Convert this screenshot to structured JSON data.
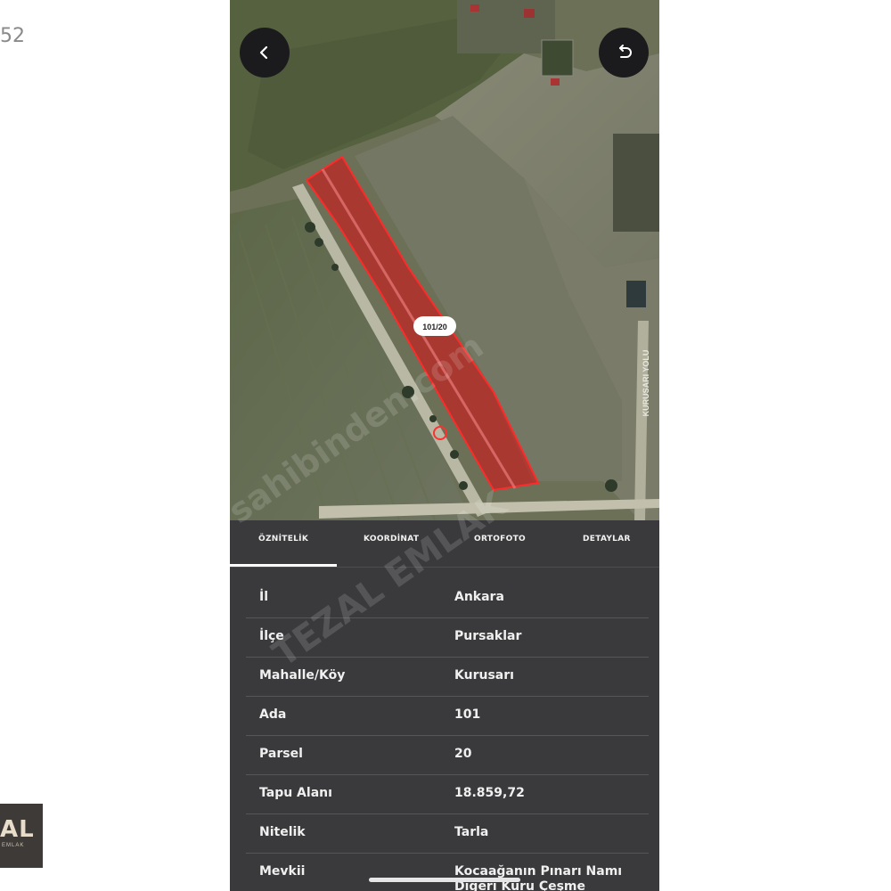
{
  "outer": {
    "time_fragment": "52",
    "logo_text": "AL",
    "logo_subtext": "EMLAK"
  },
  "map": {
    "parcel_label": "101/20",
    "road_label": "KURUSARI YOLU",
    "parcel_color": "#e02020"
  },
  "tabs": [
    {
      "label": "ÖZNİTELİK",
      "active": true
    },
    {
      "label": "KOORDİNAT",
      "active": false
    },
    {
      "label": "ORTOFOTO",
      "active": false
    },
    {
      "label": "DETAYLAR",
      "active": false
    }
  ],
  "attributes": [
    {
      "key": "İl",
      "value": "Ankara"
    },
    {
      "key": "İlçe",
      "value": "Pursaklar"
    },
    {
      "key": "Mahalle/Köy",
      "value": "Kurusarı"
    },
    {
      "key": "Ada",
      "value": "101"
    },
    {
      "key": "Parsel",
      "value": "20"
    },
    {
      "key": "Tapu Alanı",
      "value": "18.859,72"
    },
    {
      "key": "Nitelik",
      "value": "Tarla"
    },
    {
      "key": "Mevkii",
      "value": "Kocaağanın Pınarı Namı Diğeri Kuru Çeşme"
    }
  ],
  "watermark": {
    "line1": "sahibinden.com",
    "line2": "TEZAL EMLAK"
  },
  "icons": {
    "back": "chevron-left-icon",
    "reset": "undo-icon"
  }
}
